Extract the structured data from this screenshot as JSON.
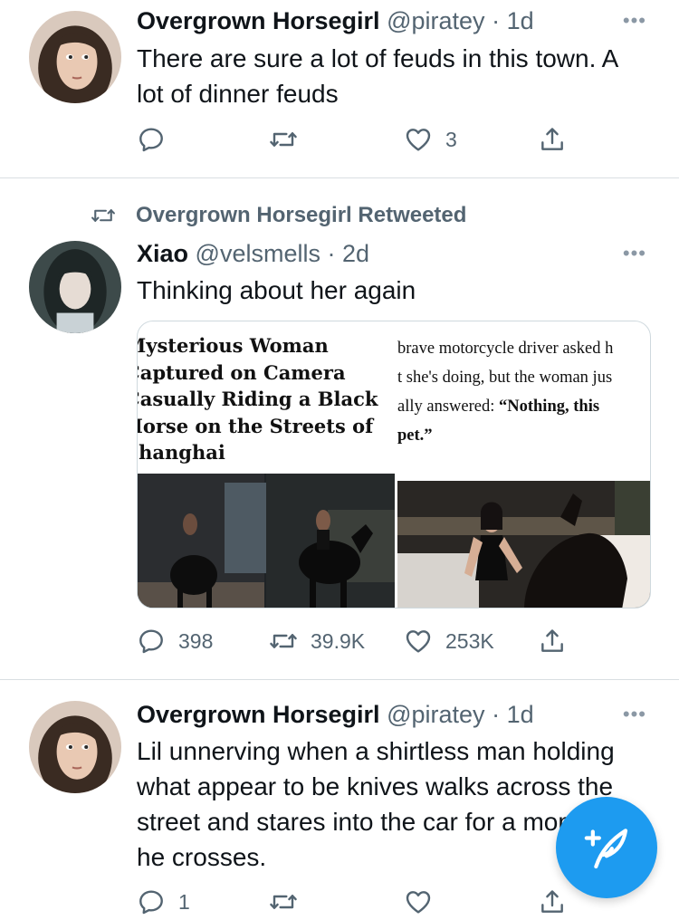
{
  "colors": {
    "accent": "#1d9bf0",
    "secondary_text": "#536471",
    "divider": "#d9dee2"
  },
  "tweets": [
    {
      "name": "Overgrown Horsegirl",
      "handle": "@piratey",
      "dot": "·",
      "time": "1d",
      "more": "•••",
      "text": "There are sure a lot of feuds in this town. A lot of dinner feuds",
      "reply_count": "",
      "retweet_count": "",
      "like_count": "3"
    },
    {
      "retweeted_by": "Overgrown Horsegirl Retweeted",
      "name": "Xiao",
      "handle": "@velsmells",
      "dot": "·",
      "time": "2d",
      "more": "•••",
      "text": "Thinking about her again",
      "media": {
        "headline_lines": [
          "Mysterious Woman",
          "Captured on Camera",
          "Casually Riding a Black",
          "Horse on the Streets of",
          "Shanghai"
        ],
        "article_lines": [
          "brave motorcycle driver asked h",
          "t she's doing, but the woman jus",
          "ally answered: ",
          "“Nothing, this",
          "pet.”"
        ]
      },
      "reply_count": "398",
      "retweet_count": "39.9K",
      "like_count": "253K"
    },
    {
      "name": "Overgrown Horsegirl",
      "handle": "@piratey",
      "dot": "·",
      "time": "1d",
      "more": "•••",
      "text": "Lil unnerving when a shirtless man holding what appear to be knives walks across the street and stares into the car for a moment as he crosses.",
      "reply_count": "1",
      "retweet_count": "",
      "like_count": ""
    }
  ],
  "icons": [
    "reply-icon",
    "retweet-icon",
    "like-icon",
    "share-icon",
    "compose-tweet-icon"
  ]
}
